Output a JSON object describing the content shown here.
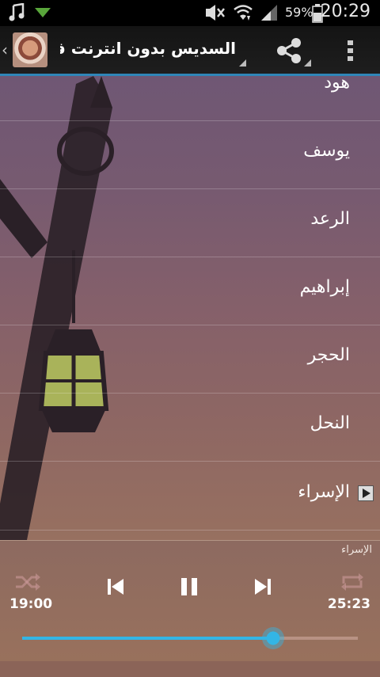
{
  "status_bar": {
    "icons": [
      "music-icon",
      "download-icon",
      "mute-icon",
      "wifi-icon",
      "signal-icon",
      "battery-icon"
    ],
    "battery": "59%",
    "time": "20:29"
  },
  "action_bar": {
    "title": "السديس بدون انترنت قرا..",
    "accent": "#2f86b8"
  },
  "surahs": [
    {
      "name": "هود",
      "playing": false
    },
    {
      "name": "يوسف",
      "playing": false
    },
    {
      "name": "الرعد",
      "playing": false
    },
    {
      "name": "إبراهيم",
      "playing": false
    },
    {
      "name": "الحجر",
      "playing": false
    },
    {
      "name": "النحل",
      "playing": false
    },
    {
      "name": "الإسراء",
      "playing": true
    }
  ],
  "player": {
    "now_playing": "الإسراء",
    "elapsed": "19:00",
    "duration": "25:23",
    "progress": 0.748,
    "accent": "#33b5e5"
  }
}
